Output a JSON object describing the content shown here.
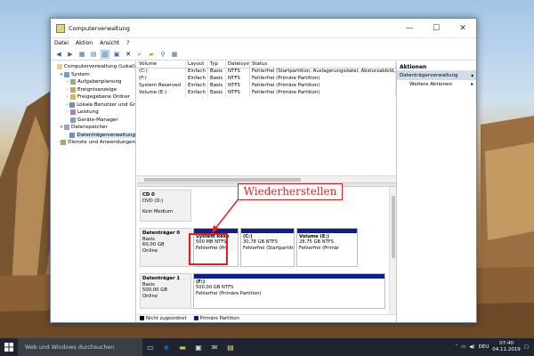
{
  "window": {
    "title": "Computerverwaltung"
  },
  "menu": [
    "Datei",
    "Aktion",
    "Ansicht",
    "?"
  ],
  "tree": [
    {
      "label": "Computerverwaltung (Lokal)",
      "level": 0,
      "expander": ""
    },
    {
      "label": "System",
      "level": 1,
      "expander": "▾"
    },
    {
      "label": "Aufgabenplanung",
      "level": 2,
      "expander": "›"
    },
    {
      "label": "Ereignisanzeige",
      "level": 2,
      "expander": "›"
    },
    {
      "label": "Freigegebene Ordner",
      "level": 2,
      "expander": "›"
    },
    {
      "label": "Lokale Benutzer und Gr",
      "level": 2,
      "expander": "›"
    },
    {
      "label": "Leistung",
      "level": 2,
      "expander": "›"
    },
    {
      "label": "Geräte-Manager",
      "level": 2,
      "expander": ""
    },
    {
      "label": "Datenspeicher",
      "level": 1,
      "expander": "▾"
    },
    {
      "label": "Datenträgerverwaltung",
      "level": 2,
      "expander": "",
      "selected": true
    },
    {
      "label": "Dienste und Anwendungen",
      "level": 1,
      "expander": "›"
    }
  ],
  "volumes": {
    "headers": [
      "Volume",
      "Layout",
      "Typ",
      "Dateisystem",
      "Status"
    ],
    "rows": [
      [
        "(C:)",
        "Einfach",
        "Basis",
        "NTFS",
        "Fehlerfrei (Startpartition, Auslagerungsdatei, Absturzabbild,"
      ],
      [
        "(F:)",
        "Einfach",
        "Basis",
        "NTFS",
        "Fehlerfrei (Primäre Partition)"
      ],
      [
        "System Reserved",
        "Einfach",
        "Basis",
        "NTFS",
        "Fehlerfrei (Primäre Partition)"
      ],
      [
        "Volume (E:)",
        "Einfach",
        "Basis",
        "NTFS",
        "Fehlerfrei (Primäre Partition)"
      ]
    ]
  },
  "disks": [
    {
      "name": "CD 0",
      "lines": [
        "DVD (D:)",
        "",
        "Kein Medium"
      ],
      "partitions": []
    },
    {
      "name": "Datenträger 0",
      "lines": [
        "Basis",
        "60,00 GB",
        "Online"
      ],
      "partitions": [
        {
          "name": "System Rese",
          "size": "500 MB NTFS",
          "status": "Fehlerfrei (Pri",
          "hatch": true
        },
        {
          "name": "(C:)",
          "size": "30,78 GB NTFS",
          "status": "Fehlerfrei (Startpartition,",
          "hatch": false
        },
        {
          "name": "Volume (E:)",
          "size": "28,75 GB NTFS",
          "status": "Fehlerfrei (Primär",
          "hatch": false
        }
      ]
    },
    {
      "name": "Datenträger 1",
      "lines": [
        "Basis",
        "500,00 GB",
        "Online"
      ],
      "partitions": [
        {
          "name": "(F:)",
          "size": "500,00 GB NTFS",
          "status": "Fehlerfrei (Primäre Partition)",
          "hatch": false
        }
      ]
    }
  ],
  "legend": [
    {
      "label": "Nicht zugeordnet",
      "color": "#000000"
    },
    {
      "label": "Primäre Partition",
      "color": "#0c1f8c"
    }
  ],
  "actions": {
    "header": "Aktionen",
    "section": "Datenträgerverwaltung",
    "item": "Weitere Aktionen"
  },
  "annotation": "Wiederherstellen",
  "taskbar": {
    "search": "Web und Windows durchsuchen",
    "time": "07:40",
    "date": "04.11.2019",
    "lang": "DEU"
  },
  "colors": {
    "partition_bar": "#0c1f8c",
    "highlight": "#e02020",
    "selection": "#cce4f7"
  }
}
